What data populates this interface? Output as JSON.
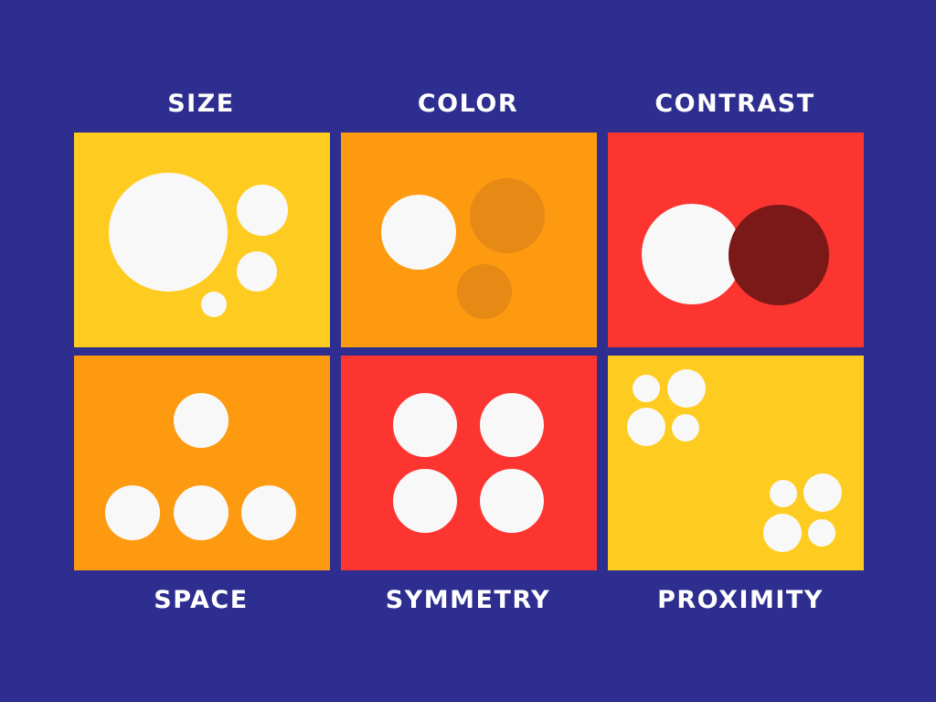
{
  "colors": {
    "background": "#2d2e8f",
    "yellow": "#fecc20",
    "orange": "#fd9a10",
    "red": "#fc3531",
    "white": "#f8f8f8",
    "muted_orange": "#e68915",
    "dark_red": "#7b1818"
  },
  "labels": {
    "size": "SIZE",
    "color": "COLOR",
    "contrast": "CONTRAST",
    "space": "SPACE",
    "symmetry": "SYMMETRY",
    "proximity": "PROXIMITY"
  }
}
